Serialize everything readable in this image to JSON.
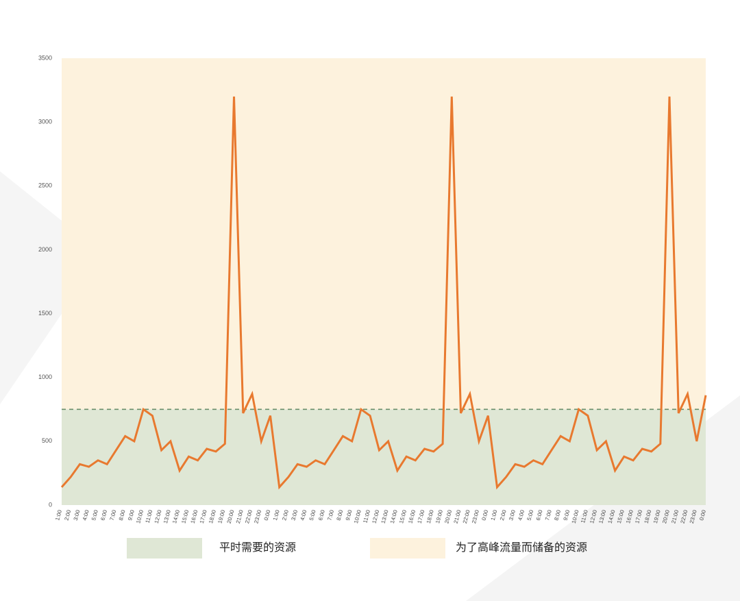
{
  "legend": {
    "normal": "平时需要的资源",
    "peak": "为了高峰流量而储备的资源"
  },
  "colors": {
    "line": "#e8792f",
    "band_normal": "#dfe7d5",
    "band_peak": "#fdf2dd",
    "threshold_dash": "#6a8f6a"
  },
  "chart_data": {
    "type": "line",
    "ylabel": "",
    "xlabel": "",
    "ylim": [
      0,
      3500
    ],
    "threshold": 750,
    "y_ticks": [
      0,
      500,
      1000,
      1500,
      2000,
      2500,
      3000,
      3500
    ],
    "categories": [
      "1:00",
      "2:00",
      "3:00",
      "4:00",
      "5:00",
      "6:00",
      "7:00",
      "8:00",
      "9:00",
      "10:00",
      "11:00",
      "12:00",
      "13:00",
      "14:00",
      "15:00",
      "16:00",
      "17:00",
      "18:00",
      "19:00",
      "20:00",
      "21:00",
      "22:00",
      "23:00",
      "0:00",
      "1:00",
      "2:00",
      "3:00",
      "4:00",
      "5:00",
      "6:00",
      "7:00",
      "8:00",
      "9:00",
      "10:00",
      "11:00",
      "12:00",
      "13:00",
      "14:00",
      "15:00",
      "16:00",
      "17:00",
      "18:00",
      "19:00",
      "20:00",
      "21:00",
      "22:00",
      "23:00",
      "0:00",
      "1:00",
      "2:00",
      "3:00",
      "4:00",
      "5:00",
      "6:00",
      "7:00",
      "8:00",
      "9:00",
      "10:00",
      "11:00",
      "12:00",
      "13:00",
      "14:00",
      "15:00",
      "16:00",
      "17:00",
      "18:00",
      "19:00",
      "20:00",
      "21:00",
      "22:00",
      "23:00",
      "0:00"
    ],
    "values": [
      140,
      220,
      320,
      300,
      350,
      320,
      430,
      540,
      500,
      750,
      700,
      430,
      500,
      270,
      380,
      350,
      440,
      420,
      480,
      3200,
      720,
      870,
      500,
      700,
      140,
      220,
      320,
      300,
      350,
      320,
      430,
      540,
      500,
      750,
      700,
      430,
      500,
      270,
      380,
      350,
      440,
      420,
      480,
      3200,
      720,
      870,
      500,
      700,
      140,
      220,
      320,
      300,
      350,
      320,
      430,
      540,
      500,
      750,
      700,
      430,
      500,
      270,
      380,
      350,
      440,
      420,
      480,
      3200,
      720,
      870,
      500,
      860
    ]
  }
}
